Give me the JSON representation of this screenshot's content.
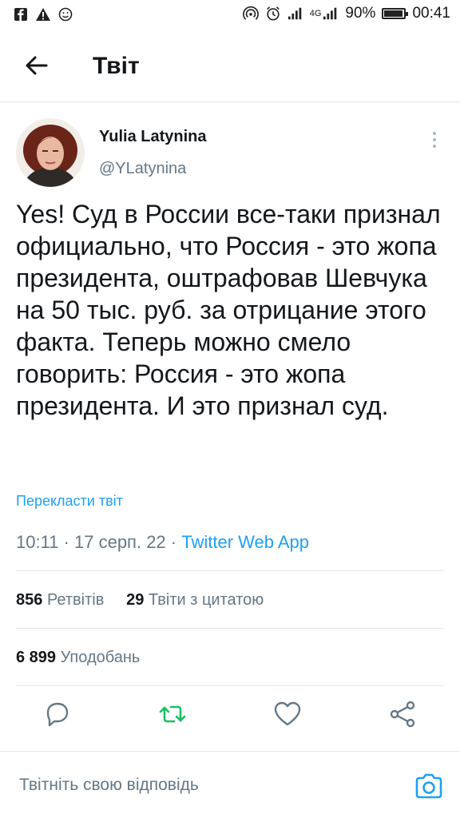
{
  "status_bar": {
    "battery": "90%",
    "network": "4G",
    "time": "00:41"
  },
  "header": {
    "title": "Твіт"
  },
  "tweet": {
    "author_name": "Yulia Latynina",
    "author_handle": "@YLatynina",
    "text": "Yes! Суд в России все-таки признал официально, что Россия - это жопа президента, оштрафовав Шевчука на 50 тыс. руб. за отрицание этого факта. Теперь можно смело говорить: Россия - это жопа президента. И это признал суд.",
    "translate_label": "Перекласти твіт",
    "time": "10:11",
    "date": "17 серп. 22",
    "source": "Twitter Web App",
    "retweets_count": "856",
    "retweets_label": "Ретвітів",
    "quotes_count": "29",
    "quotes_label": "Твіти з цитатою",
    "likes_count": "6 899",
    "likes_label": "Уподобань"
  },
  "actions": {
    "icons": [
      "reply-icon",
      "retweet-icon",
      "like-icon",
      "share-icon"
    ],
    "retweet_color": "#17bf63",
    "icon_color": "#657786"
  },
  "reply": {
    "placeholder": "Твітніть свою відповідь"
  },
  "colors": {
    "accent": "#1da1f2",
    "secondary_text": "#657786",
    "divider": "#e1e8ed"
  }
}
